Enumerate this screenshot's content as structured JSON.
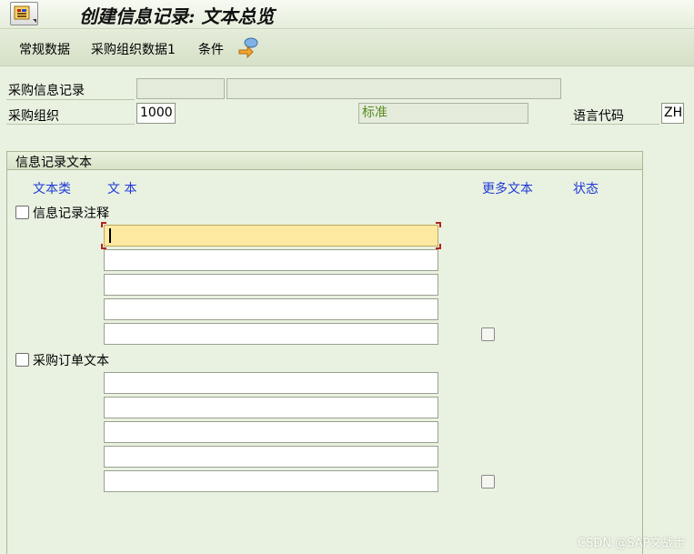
{
  "window": {
    "title": "创建信息记录: 文本总览",
    "title_icon": "sap-transaction-icon"
  },
  "toolbar": {
    "general_data": "常规数据",
    "purch_org_data": "采购组织数据1",
    "conditions": "条件",
    "extra_icon": "navigate-objects-icon"
  },
  "header": {
    "info_record_label": "采购信息记录",
    "info_record_value": "",
    "info_record_desc": "",
    "purch_org_label": "采购组织",
    "purch_org_value": "1000",
    "info_category_value": "标准",
    "language_label": "语言代码",
    "language_value": "ZH"
  },
  "text_group": {
    "title": "信息记录文本",
    "columns": {
      "text_type": "文本类",
      "text": "文 本",
      "more_text": "更多文本",
      "status": "状态"
    },
    "sections": [
      {
        "label": "信息记录注释",
        "checked": false,
        "lines": [
          "",
          "",
          "",
          "",
          ""
        ],
        "more_text": false
      },
      {
        "label": "采购订单文本",
        "checked": false,
        "lines": [
          "",
          "",
          "",
          "",
          ""
        ],
        "more_text": false
      }
    ]
  },
  "watermark": "CSDN @SAP文战士"
}
